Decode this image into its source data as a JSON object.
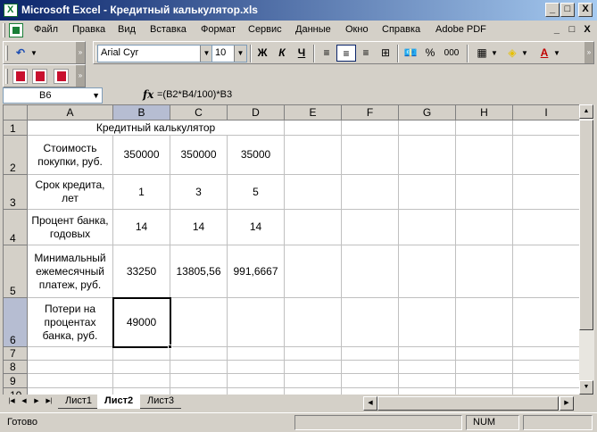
{
  "window": {
    "title": "Microsoft Excel - Кредитный калькулятор.xls",
    "caption_buttons": [
      "_",
      "□",
      "X"
    ]
  },
  "menu": {
    "items": [
      "Файл",
      "Правка",
      "Вид",
      "Вставка",
      "Формат",
      "Сервис",
      "Данные",
      "Окно",
      "Справка",
      "Adobe PDF"
    ],
    "mdi_buttons": [
      "_",
      "□",
      "X"
    ]
  },
  "toolbar": {
    "font_name": "Arial Cyr",
    "font_size": "10",
    "bold_label": "Ж",
    "italic_label": "К",
    "underline_label": "Ч",
    "percent_label": "%",
    "thousands_label": "000",
    "font_color_label": "A"
  },
  "formula_bar": {
    "name_box": "B6",
    "fx_label": "fx",
    "formula": "=(B2*B4/100)*B3"
  },
  "grid": {
    "columns": [
      "A",
      "B",
      "C",
      "D",
      "E",
      "F",
      "G",
      "H",
      "I"
    ],
    "selected_column": "B",
    "rows": [
      "1",
      "2",
      "3",
      "4",
      "5",
      "6",
      "7",
      "8",
      "9",
      "10"
    ],
    "selected_row": "6",
    "title_cell": "Кредитный калькулятор",
    "cells": {
      "A2": "Стоимость покупки, руб.",
      "B2": "350000",
      "C2": "350000",
      "D2": "35000",
      "A3": "Срок кредита, лет",
      "B3": "1",
      "C3": "3",
      "D3": "5",
      "A4": "Процент банка, годовых",
      "B4": "14",
      "C4": "14",
      "D4": "14",
      "A5": "Минимальный ежемесячный платеж, руб.",
      "B5": "33250",
      "C5": "13805,56",
      "D5": "991,6667",
      "A6": "Потери на процентах банка, руб.",
      "B6": "49000"
    }
  },
  "sheets": {
    "tabs": [
      "Лист1",
      "Лист2",
      "Лист3"
    ],
    "active": "Лист2"
  },
  "status": {
    "text": "Готово",
    "num": "NUM"
  }
}
